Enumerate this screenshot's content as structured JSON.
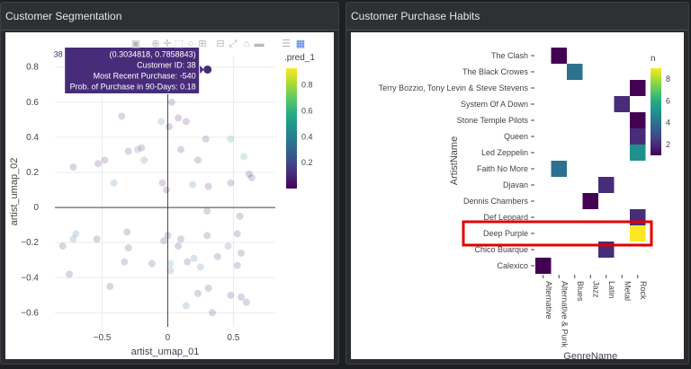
{
  "left_panel": {
    "title": "Customer Segmentation"
  },
  "right_panel": {
    "title": "Customer Purchase Habits"
  },
  "colors": {
    "viridis": [
      "#440154",
      "#472c7a",
      "#3b518b",
      "#2c718e",
      "#21908d",
      "#27ad81",
      "#5cc863",
      "#aadc32",
      "#fde725"
    ],
    "highlight": "#e00000"
  },
  "toolbar_icons": [
    "camera-icon",
    "zoom-icon",
    "pan-icon",
    "box-select-icon",
    "lasso-icon",
    "zoom-in-icon",
    "zoom-out-icon",
    "autoscale-icon",
    "reset-axes-icon",
    "spike-lines-icon",
    "compare-hover-icon",
    "plotly-logo-icon"
  ],
  "scatter_chart": {
    "chart_data": {
      "type": "scatter",
      "xlabel": "artist_umap_01",
      "ylabel": "artist_umap_02",
      "xticks": [
        -0.5,
        0,
        0.5
      ],
      "yticks": [
        -0.6,
        -0.4,
        -0.2,
        0,
        0.2,
        0.4,
        0.6,
        0.8
      ],
      "xlim": [
        -0.86,
        0.82
      ],
      "ylim": [
        -0.68,
        0.86
      ],
      "colorbar": {
        "title": ".pred_1",
        "ticks": [
          0.2,
          0.4,
          0.6,
          0.8
        ],
        "range": [
          0,
          0.93
        ]
      },
      "points": [
        {
          "x": -0.35,
          "y": 0.52,
          "c": 0.05
        },
        {
          "x": -0.05,
          "y": 0.49,
          "c": 0.35
        },
        {
          "x": 0.08,
          "y": 0.51,
          "c": 0.05
        },
        {
          "x": 0.14,
          "y": 0.49,
          "c": 0.05
        },
        {
          "x": 0.01,
          "y": 0.46,
          "c": 0.05
        },
        {
          "x": 0.03,
          "y": 0.6,
          "c": 0.05
        },
        {
          "x": 0.29,
          "y": 0.39,
          "c": 0.05
        },
        {
          "x": 0.48,
          "y": 0.39,
          "c": 0.45
        },
        {
          "x": 0.58,
          "y": 0.29,
          "c": 0.45
        },
        {
          "x": -0.2,
          "y": 0.34,
          "c": 0.05
        },
        {
          "x": -0.3,
          "y": 0.32,
          "c": 0.05
        },
        {
          "x": -0.23,
          "y": 0.33,
          "c": 0.3
        },
        {
          "x": -0.18,
          "y": 0.27,
          "c": 0.3
        },
        {
          "x": -0.48,
          "y": 0.27,
          "c": 0.05
        },
        {
          "x": -0.53,
          "y": 0.25,
          "c": 0.05
        },
        {
          "x": -0.72,
          "y": 0.23,
          "c": 0.05
        },
        {
          "x": 0.1,
          "y": 0.33,
          "c": 0.05
        },
        {
          "x": 0.23,
          "y": 0.27,
          "c": 0.05
        },
        {
          "x": 0.62,
          "y": 0.19,
          "c": 0.05
        },
        {
          "x": 0.64,
          "y": 0.17,
          "c": 0.05
        },
        {
          "x": -0.41,
          "y": 0.14,
          "c": 0.3
        },
        {
          "x": -0.04,
          "y": 0.14,
          "c": 0.05
        },
        {
          "x": -0.01,
          "y": 0.1,
          "c": 0.05
        },
        {
          "x": 0.19,
          "y": 0.13,
          "c": 0.3
        },
        {
          "x": 0.48,
          "y": 0.14,
          "c": 0.05
        },
        {
          "x": 0.31,
          "y": 0.12,
          "c": 0.05
        },
        {
          "x": 0.3,
          "y": -0.02,
          "c": 0.05
        },
        {
          "x": 0.55,
          "y": -0.05,
          "c": 0.05
        },
        {
          "x": -0.7,
          "y": -0.15,
          "c": 0.3
        },
        {
          "x": -0.72,
          "y": -0.18,
          "c": 0.3
        },
        {
          "x": -0.8,
          "y": -0.22,
          "c": 0.05
        },
        {
          "x": -0.54,
          "y": -0.18,
          "c": 0.05
        },
        {
          "x": -0.31,
          "y": -0.14,
          "c": 0.05
        },
        {
          "x": -0.3,
          "y": -0.23,
          "c": 0.05
        },
        {
          "x": 0.0,
          "y": -0.16,
          "c": 0.05
        },
        {
          "x": -0.03,
          "y": -0.19,
          "c": 0.05
        },
        {
          "x": 0.1,
          "y": -0.18,
          "c": 0.05
        },
        {
          "x": 0.08,
          "y": -0.22,
          "c": 0.05
        },
        {
          "x": 0.3,
          "y": -0.16,
          "c": 0.05
        },
        {
          "x": 0.53,
          "y": -0.15,
          "c": 0.05
        },
        {
          "x": 0.46,
          "y": -0.22,
          "c": 0.3
        },
        {
          "x": 0.56,
          "y": -0.26,
          "c": 0.05
        },
        {
          "x": -0.75,
          "y": -0.38,
          "c": 0.05
        },
        {
          "x": -0.33,
          "y": -0.31,
          "c": 0.05
        },
        {
          "x": -0.12,
          "y": -0.32,
          "c": 0.05
        },
        {
          "x": 0.02,
          "y": -0.32,
          "c": 0.45
        },
        {
          "x": 0.02,
          "y": -0.36,
          "c": 0.3
        },
        {
          "x": 0.15,
          "y": -0.31,
          "c": 0.05
        },
        {
          "x": 0.2,
          "y": -0.29,
          "c": 0.3
        },
        {
          "x": 0.25,
          "y": -0.34,
          "c": 0.3
        },
        {
          "x": 0.38,
          "y": -0.28,
          "c": 0.05
        },
        {
          "x": 0.53,
          "y": -0.33,
          "c": 0.05
        },
        {
          "x": 0.31,
          "y": -0.46,
          "c": 0.05
        },
        {
          "x": 0.48,
          "y": -0.5,
          "c": 0.05
        },
        {
          "x": 0.56,
          "y": -0.51,
          "c": 0.05
        },
        {
          "x": 0.6,
          "y": -0.54,
          "c": 0.05
        },
        {
          "x": 0.14,
          "y": -0.56,
          "c": 0.3
        },
        {
          "x": 0.34,
          "y": -0.6,
          "c": 0.05
        },
        {
          "x": -0.44,
          "y": -0.45,
          "c": 0.05
        },
        {
          "x": 0.23,
          "y": -0.49,
          "c": 0.05
        },
        {
          "x": 0.3034818,
          "y": 0.7858843,
          "c": 0.18,
          "hovered": true
        }
      ],
      "hover": {
        "label": "38",
        "lines": [
          "(0.3034818, 0.7858843)",
          "Customer ID: 38",
          "Most Recent Purchase: -540",
          "Prob. of Purchase in 90-Days: 0.18"
        ]
      }
    }
  },
  "heatmap_chart": {
    "chart_data": {
      "type": "heatmap",
      "xlabel": "GenreName",
      "ylabel": "ArtistName",
      "x": [
        "Alternative",
        "Alternative & Punk",
        "Blues",
        "Jazz",
        "Latin",
        "Metal",
        "Rock"
      ],
      "y": [
        "The Clash",
        "The Black Crowes",
        "Terry Bozzio, Tony Levin & Steve Stevens",
        "System Of A Down",
        "Stone Temple Pilots",
        "Queen",
        "Led Zeppelin",
        "Faith No More",
        "Djavan",
        "Dennis Chambers",
        "Def Leppard",
        "Deep Purple",
        "Chico Buarque",
        "Calexico"
      ],
      "cells": [
        {
          "artist": "The Clash",
          "genre": "Alternative & Punk",
          "n": 1
        },
        {
          "artist": "The Black Crowes",
          "genre": "Blues",
          "n": 4
        },
        {
          "artist": "Terry Bozzio, Tony Levin & Steve Stevens",
          "genre": "Rock",
          "n": 1
        },
        {
          "artist": "System Of A Down",
          "genre": "Metal",
          "n": 2
        },
        {
          "artist": "Stone Temple Pilots",
          "genre": "Rock",
          "n": 1
        },
        {
          "artist": "Queen",
          "genre": "Rock",
          "n": 2
        },
        {
          "artist": "Led Zeppelin",
          "genre": "Rock",
          "n": 5
        },
        {
          "artist": "Faith No More",
          "genre": "Alternative & Punk",
          "n": 4
        },
        {
          "artist": "Djavan",
          "genre": "Latin",
          "n": 2
        },
        {
          "artist": "Dennis Chambers",
          "genre": "Jazz",
          "n": 1
        },
        {
          "artist": "Def Leppard",
          "genre": "Rock",
          "n": 2
        },
        {
          "artist": "Deep Purple",
          "genre": "Rock",
          "n": 9
        },
        {
          "artist": "Chico Buarque",
          "genre": "Latin",
          "n": 2
        },
        {
          "artist": "Calexico",
          "genre": "Alternative",
          "n": 1
        }
      ],
      "colorbar": {
        "title": "n",
        "ticks": [
          2,
          4,
          6,
          8
        ],
        "range": [
          1,
          9
        ]
      },
      "highlighted_row": "Deep Purple"
    }
  }
}
